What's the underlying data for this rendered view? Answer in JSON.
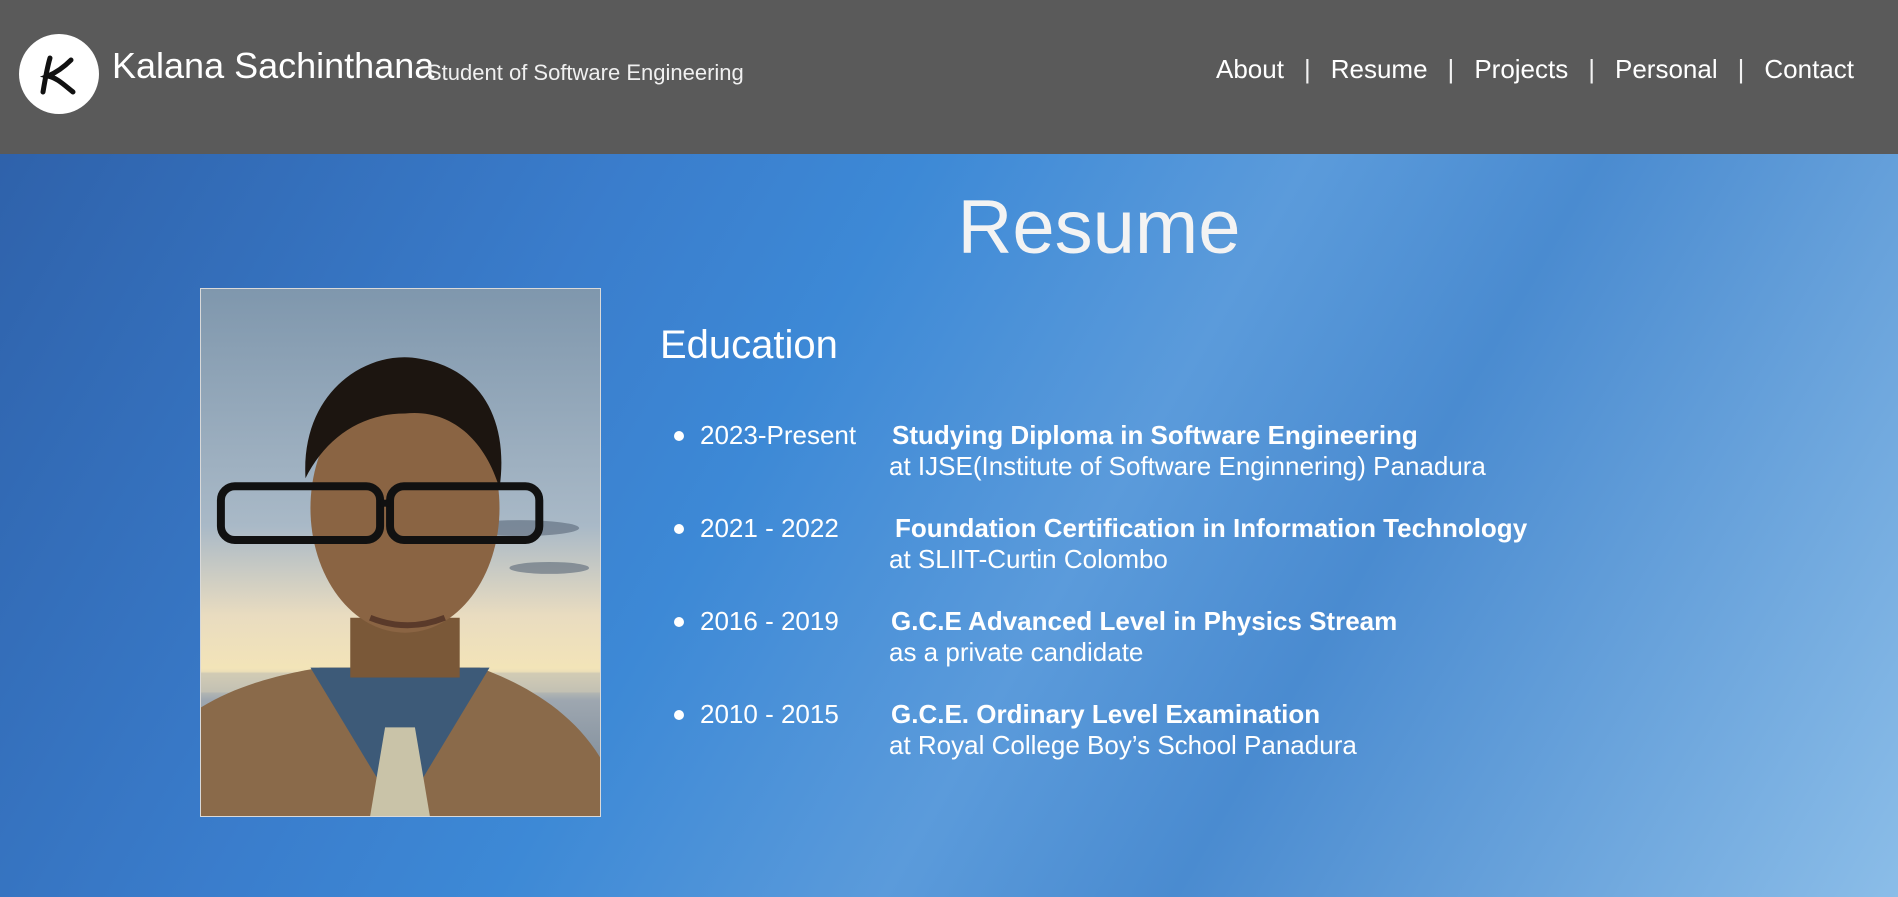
{
  "header": {
    "logo_letter": "K",
    "name": "Kalana Sachinthana",
    "tagline": "Student of Software Engineering",
    "background": "#5a5a5a"
  },
  "nav": {
    "items": [
      {
        "label": "About"
      },
      {
        "label": "Resume"
      },
      {
        "label": "Projects"
      },
      {
        "label": "Personal"
      },
      {
        "label": "Contact"
      }
    ],
    "separator": "|"
  },
  "main": {
    "title": "Resume",
    "section_heading": "Education",
    "education": [
      {
        "period": "2023-Present",
        "degree": "Studying Diploma in Software Engineering",
        "institution": "at IJSE(Institute of Software Enginnering) Panadura"
      },
      {
        "period": "2021 - 2022",
        "degree": "Foundation Certification in Information Technology",
        "institution": "at SLIIT-Curtin Colombo"
      },
      {
        "period": "2016 - 2019",
        "degree": "G.C.E Advanced Level in Physics Stream",
        "institution": "as a private candidate"
      },
      {
        "period": "2010 - 2015",
        "degree": "G.C.E. Ordinary Level Examination",
        "institution": "at Royal College Boy’s School Panadura"
      }
    ]
  },
  "colors": {
    "background_gradient_start": "#2d5ea6",
    "background_gradient_mid": "#3d89d6",
    "background_gradient_end": "#8bbde8",
    "text": "#ffffff"
  }
}
